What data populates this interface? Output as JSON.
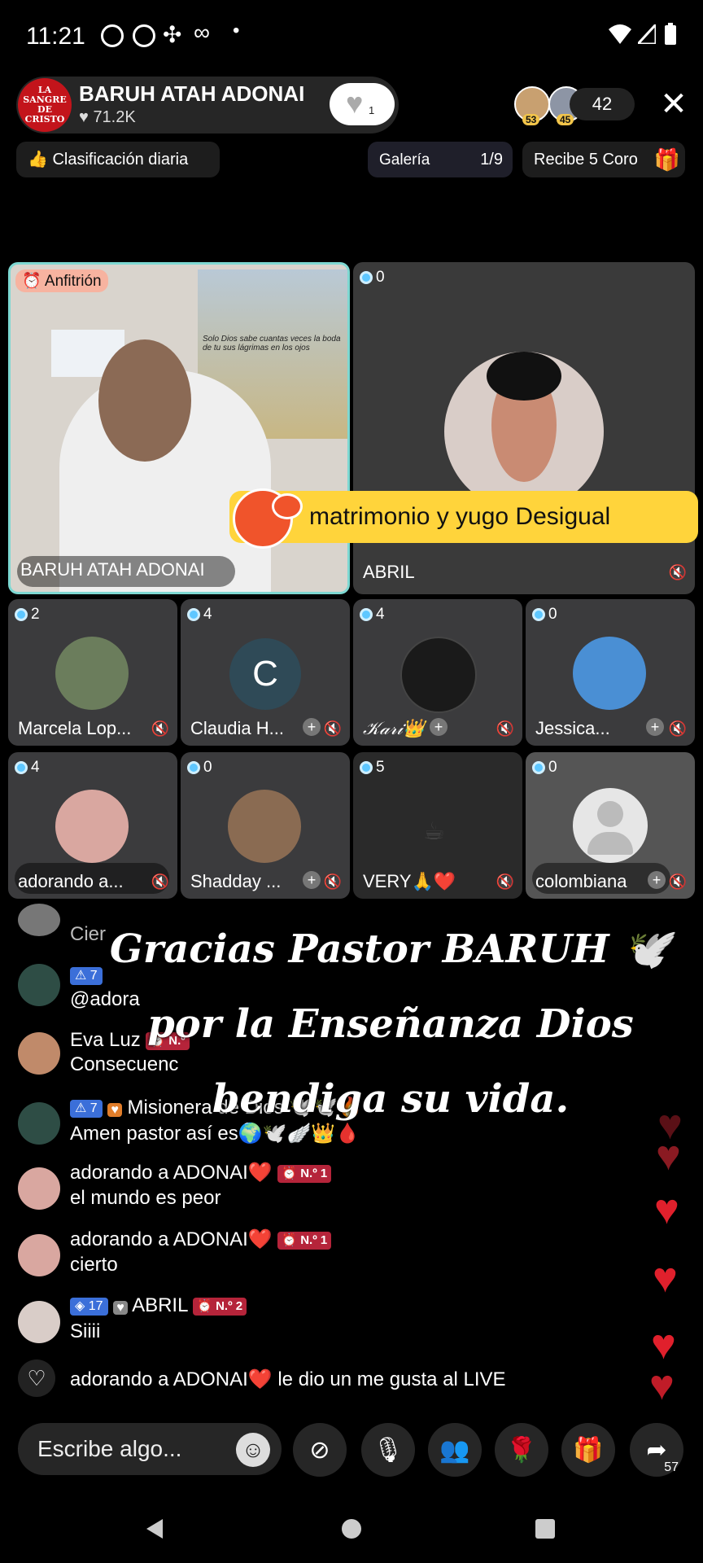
{
  "status_bar": {
    "time": "11:21"
  },
  "host": {
    "avatar_text": "LA SANGRE DE CRISTO",
    "name": "BARUH ATAH ADONAI",
    "likes": "71.2K",
    "like_button_count": "1"
  },
  "viewers": [
    {
      "badge": "53"
    },
    {
      "badge": "45"
    }
  ],
  "viewer_count": "42",
  "chips": {
    "daily_ranking": "Clasificación diaria",
    "gallery_label": "Galería",
    "gallery_page": "1/9",
    "rewards": "Recibe 5 Coro"
  },
  "topic_banner": "matrimonio y yugo Desigual",
  "host_tile": {
    "badge": "Anfitrión",
    "name": "BARUH ATAH ADONAI",
    "poster_text": "Solo Dios sabe cuantas veces la boda de tu sus lágrimas en los ojos"
  },
  "main_guest": {
    "seat_count": "0",
    "name": "ABRIL"
  },
  "guests": [
    {
      "count": "2",
      "name": "Marcela Lop...",
      "avatar_color": "#6b7d5c"
    },
    {
      "count": "4",
      "name": "Claudia H...",
      "avatar_letter": "C",
      "avatar_color": "#2f4a57"
    },
    {
      "count": "4",
      "name": "𝒦𝒶𝓇𝒾👑",
      "avatar_color": "#1a1a1a"
    },
    {
      "count": "0",
      "name": "Jessica...",
      "avatar_color": "#4a8fd4"
    },
    {
      "count": "4",
      "name": "adorando a...",
      "avatar_color": "#d9a7a0"
    },
    {
      "count": "0",
      "name": "Shadday ...",
      "avatar_color": "#8a6b52"
    },
    {
      "count": "5",
      "name": "VERY🙏❤️",
      "avatar_color": "#2b2b2b"
    },
    {
      "count": "0",
      "name": "colombiana",
      "avatar_color": "#e6e6e6"
    }
  ],
  "overlay_text": [
    "Gracias Pastor BARUH 🕊️",
    "por la Enseñanza Dios",
    "bendiga su vida."
  ],
  "chat": [
    {
      "name": "Cier",
      "msg": ""
    },
    {
      "level": "7",
      "name": "",
      "msg": "@adora"
    },
    {
      "name": "Eva Luz",
      "rank": "N.º",
      "msg": "Consecuenc"
    },
    {
      "level": "7",
      "name": "Misionera de Dios 🕊️🕊️🔥",
      "msg": "Amen pastor así es🌍🕊️🪽👑🩸"
    },
    {
      "name": "adorando a ADONAI❤️",
      "rank": "N.º 1",
      "msg": "el mundo es peor"
    },
    {
      "name": "adorando a ADONAI❤️",
      "rank": "N.º 1",
      "msg": "cierto"
    },
    {
      "level": "17",
      "name": "ABRIL",
      "rank": "N.º 2",
      "msg": "Siiii"
    }
  ],
  "like_notice": "adorando a ADONAI❤️ le dio un me gusta al LIVE",
  "bottom_bar": {
    "placeholder": "Escribe algo...",
    "share_count": "57"
  },
  "colors": {
    "accent_yellow": "#ffd43b",
    "heart_red": "#e0202c",
    "level_blue": "#3b6fd9",
    "rank_red": "#b5243a"
  }
}
